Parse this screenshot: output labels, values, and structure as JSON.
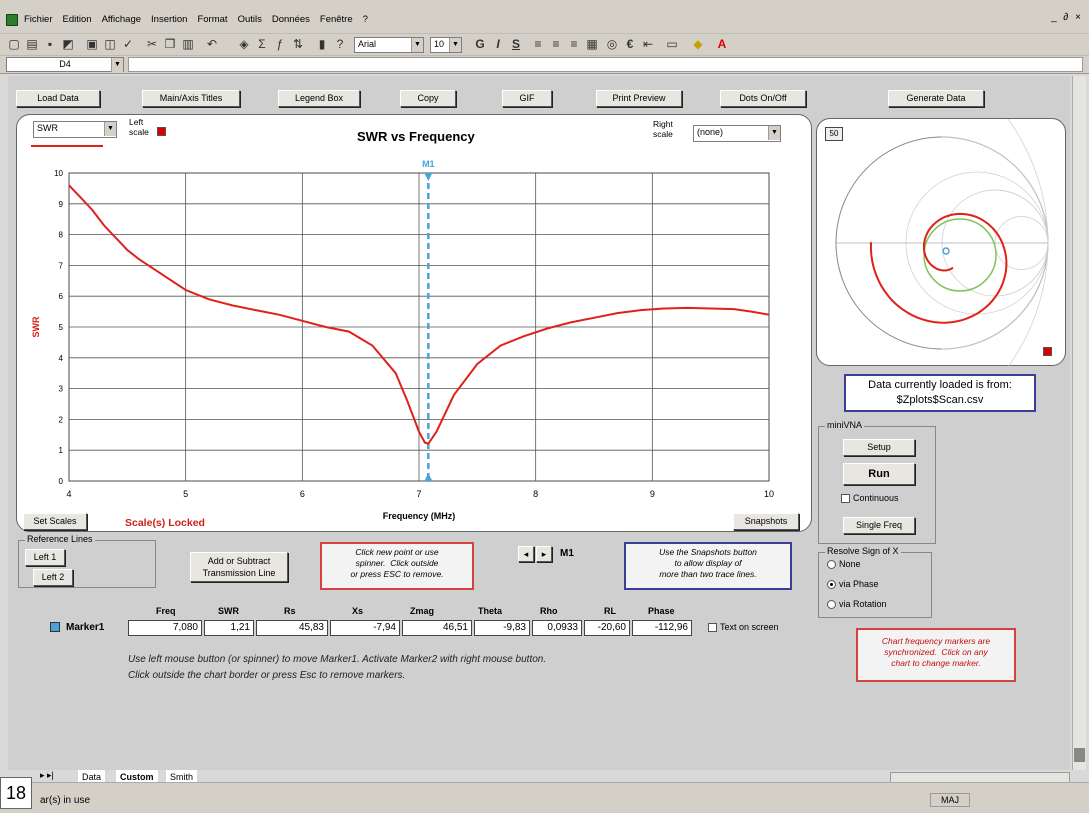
{
  "menubar": {
    "items": [
      "Fichier",
      "Edition",
      "Affichage",
      "Insertion",
      "Format",
      "Outils",
      "Données",
      "Fenêtre",
      "?"
    ],
    "window_controls": "_ ∂ ×"
  },
  "toolbar": {
    "font": "Arial",
    "size": "10",
    "bold": "G",
    "italic": "I",
    "underline": "S",
    "euro": "€"
  },
  "formula_bar": {
    "cell_ref": "D4"
  },
  "buttons": {
    "load_data": "Load Data",
    "titles": "Main/Axis Titles",
    "legend": "Legend Box",
    "copy": "Copy",
    "gif": "GIF",
    "print_preview": "Print Preview",
    "dots": "Dots On/Off",
    "generate": "Generate Data",
    "set_scales": "Set Scales",
    "snapshots": "Snapshots",
    "left1": "Left 1",
    "left2": "Left 2",
    "add_tline": "Add or Subtract\nTransmission Line",
    "setup": "Setup",
    "run": "Run",
    "single_freq": "Single Freq"
  },
  "chart_panel": {
    "left_select": "SWR",
    "left_scale_label": "Left\nscale",
    "right_scale_label": "Right\nscale",
    "right_select": "(none)",
    "scale_locked": "Scale(s) Locked",
    "marker_label": "M1",
    "marker_nav": "M1"
  },
  "chart_data": {
    "type": "line",
    "title": "SWR  vs  Frequency",
    "xlabel": "Frequency (MHz)",
    "ylabel": "SWR",
    "xlim": [
      4,
      10
    ],
    "ylim": [
      0,
      10
    ],
    "xticks": [
      "4",
      "5",
      "6",
      "7",
      "8",
      "9",
      "10"
    ],
    "yticks": [
      "0",
      "1",
      "2",
      "3",
      "4",
      "5",
      "6",
      "7",
      "8",
      "9",
      "10"
    ],
    "grid": true,
    "series": [
      {
        "color": "#e0201a",
        "x": [
          4.0,
          4.1,
          4.2,
          4.3,
          4.4,
          4.5,
          4.6,
          4.8,
          5.0,
          5.2,
          5.4,
          5.6,
          5.8,
          6.0,
          6.2,
          6.4,
          6.6,
          6.8,
          6.9,
          7.0,
          7.05,
          7.08,
          7.15,
          7.3,
          7.5,
          7.7,
          7.9,
          8.1,
          8.3,
          8.5,
          8.7,
          8.9,
          9.1,
          9.3,
          9.5,
          9.7,
          9.85,
          10.0
        ],
        "y": [
          9.6,
          9.2,
          8.8,
          8.3,
          7.9,
          7.5,
          7.2,
          6.7,
          6.2,
          5.9,
          5.7,
          5.55,
          5.4,
          5.2,
          5.0,
          4.85,
          4.4,
          3.5,
          2.6,
          1.6,
          1.25,
          1.21,
          1.6,
          2.8,
          3.8,
          4.4,
          4.7,
          4.95,
          5.15,
          5.3,
          5.45,
          5.55,
          5.6,
          5.62,
          5.6,
          5.58,
          5.5,
          5.4
        ]
      }
    ],
    "marker": {
      "x": 7.08,
      "color": "#4aa3d8",
      "label": "M1"
    }
  },
  "smith": {
    "impedance_label": "50",
    "loaded_line1": "Data currently loaded is from:",
    "loaded_line2": "$Zplots$Scan.csv"
  },
  "reference_lines": {
    "legend": "Reference Lines"
  },
  "notes": {
    "click_new": "Click new point or use\nspinner.  Click outside\nor press ESC to remove.",
    "snapshots": "Use the Snapshots button\nto allow display of\nmore than two trace lines.",
    "sync": "Chart frequency markers are\nsynchronized.  Click on any\nchart to change marker."
  },
  "minivna": {
    "legend": "miniVNA",
    "continuous": "Continuous"
  },
  "resolve": {
    "legend": "Resolve Sign of X",
    "options": [
      "None",
      "via Phase",
      "via Rotation"
    ],
    "selected": "via Phase"
  },
  "marker_table": {
    "name": "Marker1",
    "headers": [
      "Freq",
      "SWR",
      "Rs",
      "Xs",
      "Zmag",
      "Theta",
      "Rho",
      "RL",
      "Phase"
    ],
    "values": [
      "7,080",
      "1,21",
      "45,83",
      "-7,94",
      "46,51",
      "-9,83",
      "0,0933",
      "-20,60",
      "-112,96"
    ],
    "text_on_screen": "Text on screen"
  },
  "instructions": {
    "line1": "Use left mouse button (or spinner) to move Marker1.  Activate Marker2 with right mouse button.",
    "line2": "Click outside the chart border or press Esc to remove markers."
  },
  "sheet_tabs": [
    "Data",
    "Custom",
    "Smith"
  ],
  "active_tab": "Custom",
  "status": {
    "page_number": "18",
    "text": "ar(s) in use",
    "caps": "MAJ"
  }
}
